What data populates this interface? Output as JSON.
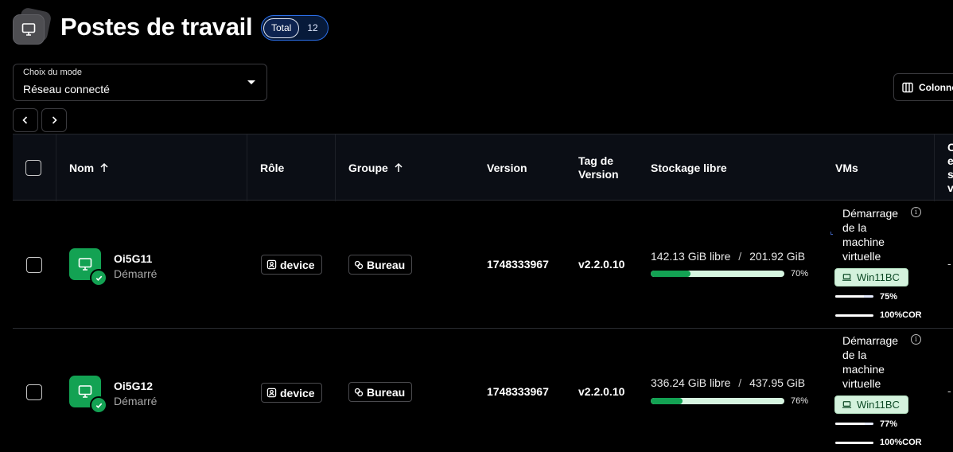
{
  "header": {
    "title": "Postes de travail",
    "total_label": "Total",
    "total_count": "12"
  },
  "mode": {
    "label": "Choix du mode",
    "value": "Réseau connecté"
  },
  "columns_button": "Colonnes",
  "table": {
    "columns": {
      "name": "Nom",
      "role": "Rôle",
      "group": "Groupe",
      "version": "Version",
      "tag_line1": "Tag de",
      "tag_line2": "Version",
      "storage": "Stockage libre",
      "vms": "VMs",
      "extra_1": "C",
      "extra_2": "e",
      "extra_3": "s",
      "extra_4": "v"
    },
    "rows": [
      {
        "name": "Oi5G11",
        "status": "Démarré",
        "role": "device",
        "group": "Bureau",
        "version": "1748333967",
        "tag": "v2.2.0.10",
        "storage_free": "142.13 GiB libre",
        "storage_sep": "/",
        "storage_total": "201.92 GiB",
        "storage_pct": "70%",
        "storage_fraction": 0.3,
        "vm_line1": "Démarrage",
        "vm_line2": "de la",
        "vm_line3": "machine",
        "vm_line4": "virtuelle",
        "vm_name": "Win11BC",
        "vm_mem_pct": "75%",
        "vm_mem_fraction": 0.75,
        "vm_cpu_pct": "100%COR",
        "vm_cpu_fraction": 1.0,
        "extra": "-"
      },
      {
        "name": "Oi5G12",
        "status": "Démarré",
        "role": "device",
        "group": "Bureau",
        "version": "1748333967",
        "tag": "v2.2.0.10",
        "storage_free": "336.24 GiB libre",
        "storage_sep": "/",
        "storage_total": "437.95 GiB",
        "storage_pct": "76%",
        "storage_fraction": 0.24,
        "vm_line1": "Démarrage",
        "vm_line2": "de la",
        "vm_line3": "machine",
        "vm_line4": "virtuelle",
        "vm_name": "Win11BC",
        "vm_mem_pct": "77%",
        "vm_mem_fraction": 0.77,
        "vm_cpu_pct": "100%COR",
        "vm_cpu_fraction": 1.0,
        "extra": "-"
      }
    ]
  },
  "colors": {
    "accent_green": "#13a253",
    "badge_blue": "#2b6ee8"
  }
}
